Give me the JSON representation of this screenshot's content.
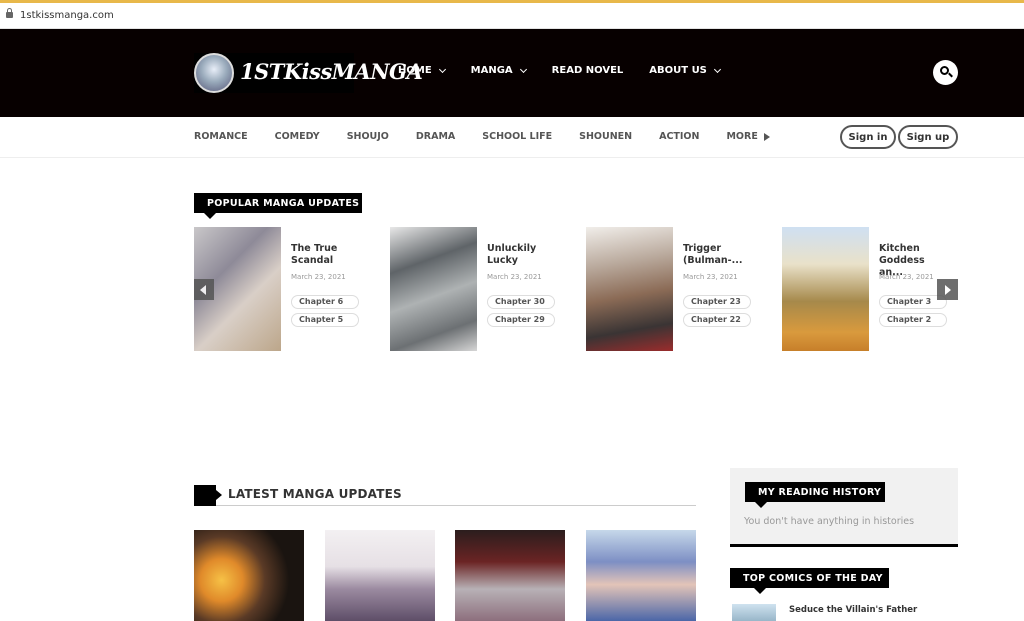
{
  "browser": {
    "url": "1stkissmanga.com"
  },
  "header": {
    "logo_text": "1STKissMANGA",
    "nav": [
      {
        "label": "HOME",
        "dropdown": true
      },
      {
        "label": "MANGA",
        "dropdown": true
      },
      {
        "label": "READ NOVEL",
        "dropdown": false
      },
      {
        "label": "ABOUT US",
        "dropdown": true
      }
    ]
  },
  "genres": [
    "ROMANCE",
    "COMEDY",
    "SHOUJO",
    "DRAMA",
    "SCHOOL LIFE",
    "SHOUNEN",
    "ACTION",
    "MORE"
  ],
  "auth": {
    "signin": "Sign in",
    "signup": "Sign up"
  },
  "popular": {
    "heading": "POPULAR MANGA UPDATES",
    "items": [
      {
        "title": "The True Scandal",
        "date": "March 23, 2021",
        "chapters": [
          "Chapter 6",
          "Chapter 5"
        ]
      },
      {
        "title": "Unluckily Lucky",
        "date": "March 23, 2021",
        "chapters": [
          "Chapter 30",
          "Chapter 29"
        ]
      },
      {
        "title": "Trigger (Bulman-...",
        "date": "March 23, 2021",
        "chapters": [
          "Chapter 23",
          "Chapter 22"
        ]
      },
      {
        "title": "Kitchen Goddess an...",
        "date": "March 23, 2021",
        "chapters": [
          "Chapter 3",
          "Chapter 2"
        ]
      }
    ]
  },
  "latest": {
    "heading": "LATEST MANGA UPDATES"
  },
  "sidebar": {
    "history_heading": "MY READING HISTORY",
    "history_empty": "You don't have anything in histories",
    "top_heading": "TOP COMICS OF THE DAY",
    "top_items": [
      {
        "title": "Seduce the Villain's Father"
      }
    ]
  },
  "colors": {
    "header_bg": "#070000",
    "tag_bg": "#000000",
    "url_accent": "#e8b84a"
  }
}
